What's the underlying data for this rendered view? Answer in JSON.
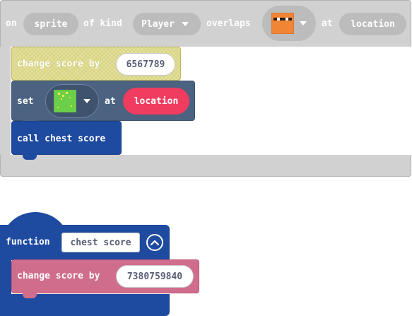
{
  "event_block": {
    "on": "on",
    "sprite": "sprite",
    "of_kind": "of kind",
    "kind_value": "Player",
    "overlaps": "overlaps",
    "at": "at",
    "location": "location"
  },
  "change_score_1": {
    "label": "change score by",
    "value": "6567789"
  },
  "set_block": {
    "set": "set",
    "at": "at",
    "location": "location"
  },
  "call_block": {
    "label": "call chest score"
  },
  "function_block": {
    "function": "function",
    "name": "chest score"
  },
  "change_score_2": {
    "label": "change score by",
    "value": "7380759840"
  },
  "colors": {
    "event_gray": "#d1d1d1",
    "score_yellow": "#d8d47f",
    "set_slate": "#4b6281",
    "function_blue": "#1e4aa0",
    "score_pink": "#d06d8c",
    "location_red": "#ef3c5f"
  }
}
